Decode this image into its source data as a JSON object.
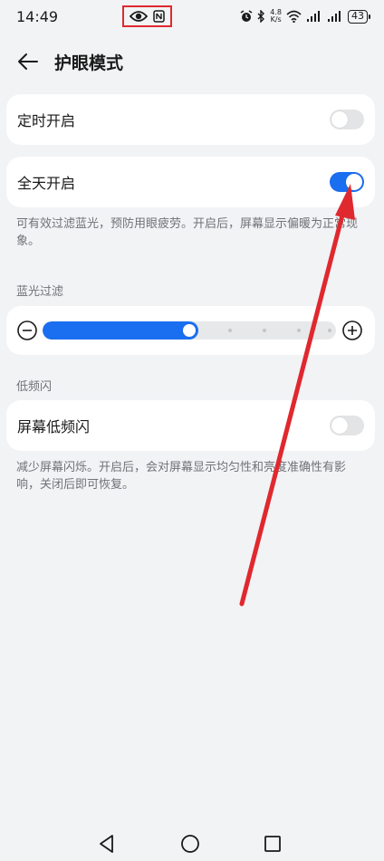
{
  "status_bar": {
    "time": "14:49",
    "net_speed_value": "4.8",
    "net_speed_unit": "K/s",
    "battery": "43"
  },
  "header": {
    "title": "护眼模式"
  },
  "scheduled": {
    "label": "定时开启",
    "enabled": false
  },
  "all_day": {
    "label": "全天开启",
    "enabled": true,
    "description": "可有效过滤蓝光，预防用眼疲劳。开启后，屏幕显示偏暖为正常现象。"
  },
  "blue_light": {
    "section_title": "蓝光过滤",
    "level": 0.53
  },
  "low_flicker": {
    "section_title": "低频闪",
    "label": "屏幕低频闪",
    "enabled": false,
    "description": "减少屏幕闪烁。开启后，会对屏幕显示均匀性和亮度准确性有影响，关闭后即可恢复。"
  },
  "colors": {
    "accent": "#1a6ef0",
    "annotation": "#e0282f"
  },
  "icons": {
    "back": "arrow-left-icon",
    "eye": "eye-icon",
    "nfc": "nfc-icon",
    "alarm": "alarm-icon",
    "bluetooth": "bluetooth-icon",
    "wifi": "wifi-icon",
    "signal": "signal-icon",
    "minus": "minus-circle-icon",
    "plus": "plus-circle-icon"
  }
}
